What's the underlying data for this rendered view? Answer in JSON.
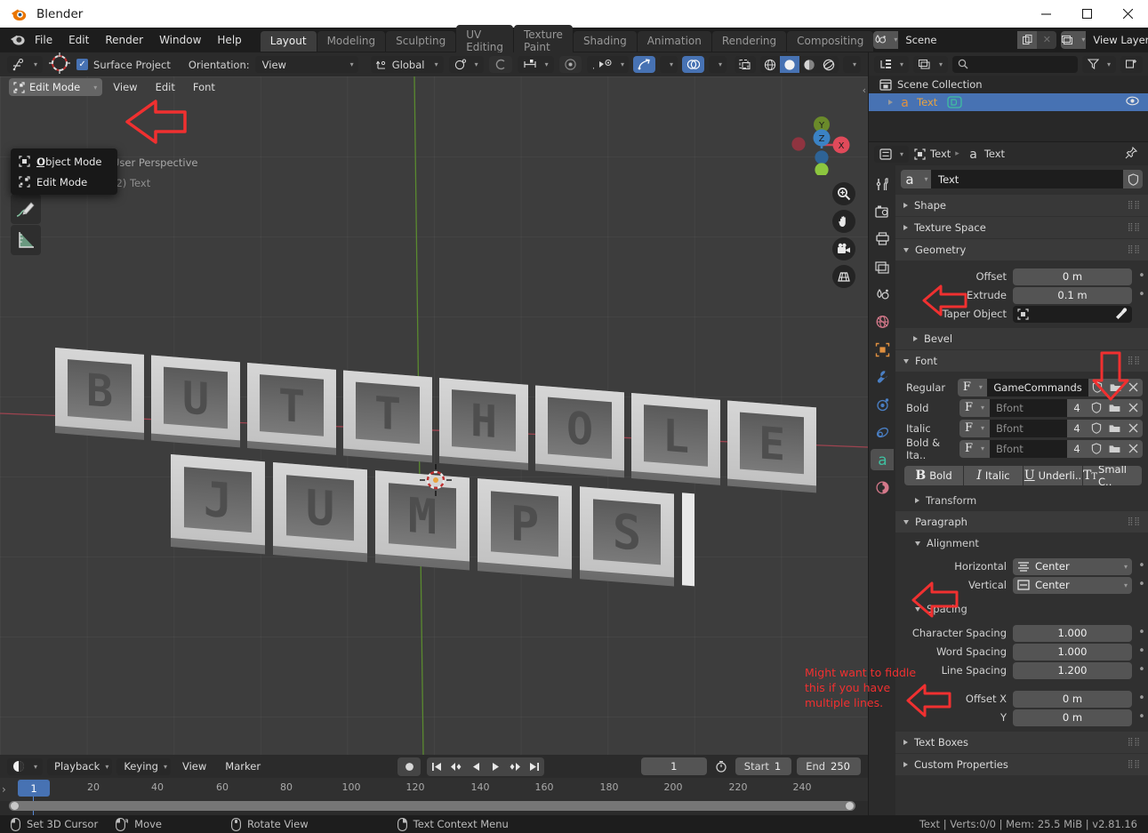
{
  "window": {
    "title": "Blender",
    "minimize": "─",
    "maximize": "☐",
    "close": "✕"
  },
  "topbar": {
    "menus": [
      "File",
      "Edit",
      "Render",
      "Window",
      "Help"
    ],
    "workspaces": [
      "Layout",
      "Modeling",
      "Sculpting",
      "UV Editing",
      "Texture Paint",
      "Shading",
      "Animation",
      "Rendering",
      "Compositing"
    ],
    "active_workspace": "Layout",
    "scene_name": "Scene",
    "view_layer_name": "View Layer"
  },
  "viewport": {
    "header": {
      "surface_project_label": "Surface Project",
      "surface_project_checked": true,
      "orientation_label": "Orientation:",
      "orientation_value": "View",
      "transform_space": "Global"
    },
    "mode_button": "Edit Mode",
    "menus": [
      "View",
      "Edit",
      "Font"
    ],
    "mode_dropdown": {
      "open": true,
      "items": [
        "Object Mode",
        "Edit Mode"
      ]
    },
    "overlay_view_label": "User Perspective",
    "overlay_object_label": "(2) Text",
    "gizmo_axes": [
      "X",
      "Y",
      "Z"
    ],
    "text_object_lines": [
      "BUTTHOLE",
      "JUMPS"
    ]
  },
  "timeline": {
    "menus": [
      "Playback",
      "Keying",
      "View",
      "Marker"
    ],
    "current_frame": "1",
    "start_label": "Start",
    "start_value": "1",
    "end_label": "End",
    "end_value": "250",
    "ticks": [
      "20",
      "40",
      "60",
      "80",
      "100",
      "120",
      "140",
      "160",
      "180",
      "200",
      "220",
      "240"
    ],
    "playhead_label": "1"
  },
  "outliner": {
    "scene_collection": "Scene Collection",
    "object_name": "Text"
  },
  "properties": {
    "breadcrumb_object": "Text",
    "breadcrumb_data": "Text",
    "datablock_name": "Text",
    "panels": {
      "shape": "Shape",
      "texture_space": "Texture Space",
      "geometry": "Geometry",
      "bevel": "Bevel",
      "font": "Font",
      "transform": "Transform",
      "paragraph": "Paragraph",
      "alignment": "Alignment",
      "spacing": "Spacing",
      "text_boxes": "Text Boxes",
      "custom_properties": "Custom Properties"
    },
    "geometry": {
      "offset_label": "Offset",
      "offset_value": "0 m",
      "extrude_label": "Extrude",
      "extrude_value": "0.1 m",
      "taper_label": "Taper Object"
    },
    "font": {
      "rows": [
        {
          "label": "Regular",
          "value": "GameCommands",
          "placeholder": false,
          "users": ""
        },
        {
          "label": "Bold",
          "value": "Bfont",
          "placeholder": true,
          "users": "4"
        },
        {
          "label": "Italic",
          "value": "Bfont",
          "placeholder": true,
          "users": "4"
        },
        {
          "label": "Bold & Ita..",
          "value": "Bfont",
          "placeholder": true,
          "users": "4"
        }
      ],
      "styles": [
        "Bold",
        "Italic",
        "Underli..",
        "Small C.."
      ]
    },
    "alignment": {
      "horizontal_label": "Horizontal",
      "horizontal_value": "Center",
      "vertical_label": "Vertical",
      "vertical_value": "Center"
    },
    "spacing": {
      "character_label": "Character Spacing",
      "character_value": "1.000",
      "word_label": "Word Spacing",
      "word_value": "1.000",
      "line_label": "Line Spacing",
      "line_value": "1.200",
      "offset_x_label": "Offset X",
      "offset_x_value": "0 m",
      "offset_y_label": "Y",
      "offset_y_value": "0 m"
    }
  },
  "annotations": {
    "spacing_note": "Might want to fiddle\nthis if you have\nmultiple lines.",
    "spacing_note_line1": "Might want to fiddle",
    "spacing_note_line2": "this if you have",
    "spacing_note_line3": "multiple lines.",
    "color": "#f03030"
  },
  "statusbar": {
    "items": [
      "Set 3D Cursor",
      "Move",
      "Rotate View",
      "Text Context Menu"
    ],
    "info": "Text | Verts:0/0 | Mem: 25.5 MiB | v2.81.16"
  }
}
